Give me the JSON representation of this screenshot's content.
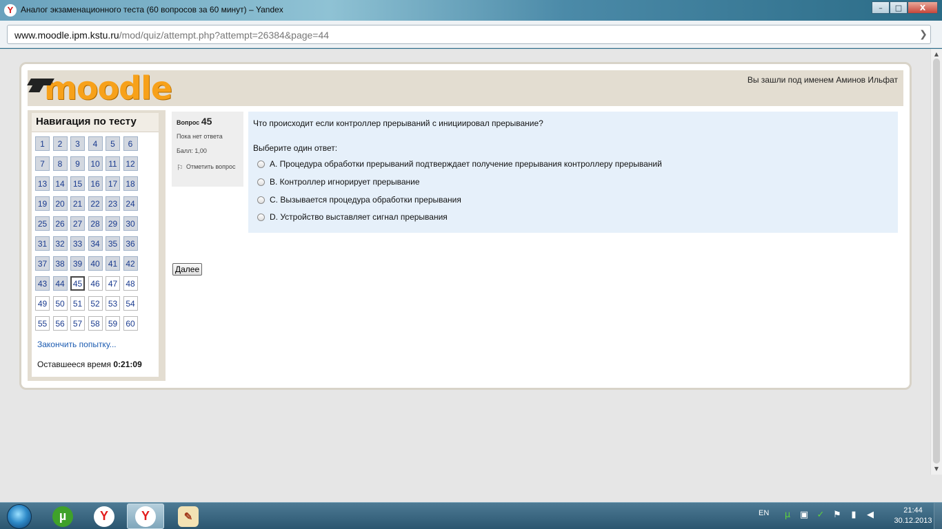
{
  "window": {
    "title": "Аналог экзаменационного теста (60 вопросов за 60 минут) – Yandex",
    "buttons": {
      "minimize": "–",
      "maximize": "□",
      "close": "X"
    }
  },
  "address": {
    "host": "www.moodle.ipm.kstu.ru",
    "path": "/mod/quiz/attempt.php?attempt=26384&page=44",
    "arrow": "❯"
  },
  "header": {
    "logo": "moodle",
    "login_info": "Вы зашли под именем Аминов Ильфат"
  },
  "nav": {
    "title": "Навигация по тесту",
    "questions": [
      {
        "n": "1",
        "s": "answered"
      },
      {
        "n": "2",
        "s": "answered"
      },
      {
        "n": "3",
        "s": "answered"
      },
      {
        "n": "4",
        "s": "answered"
      },
      {
        "n": "5",
        "s": "answered"
      },
      {
        "n": "6",
        "s": "answered"
      },
      {
        "n": "7",
        "s": "answered"
      },
      {
        "n": "8",
        "s": "answered"
      },
      {
        "n": "9",
        "s": "answered"
      },
      {
        "n": "10",
        "s": "answered"
      },
      {
        "n": "11",
        "s": "answered"
      },
      {
        "n": "12",
        "s": "answered"
      },
      {
        "n": "13",
        "s": "answered"
      },
      {
        "n": "14",
        "s": "answered"
      },
      {
        "n": "15",
        "s": "answered"
      },
      {
        "n": "16",
        "s": "answered"
      },
      {
        "n": "17",
        "s": "answered"
      },
      {
        "n": "18",
        "s": "answered"
      },
      {
        "n": "19",
        "s": "answered"
      },
      {
        "n": "20",
        "s": "answered"
      },
      {
        "n": "21",
        "s": "answered"
      },
      {
        "n": "22",
        "s": "answered"
      },
      {
        "n": "23",
        "s": "answered"
      },
      {
        "n": "24",
        "s": "answered"
      },
      {
        "n": "25",
        "s": "answered"
      },
      {
        "n": "26",
        "s": "answered"
      },
      {
        "n": "27",
        "s": "answered"
      },
      {
        "n": "28",
        "s": "answered"
      },
      {
        "n": "29",
        "s": "answered"
      },
      {
        "n": "30",
        "s": "answered"
      },
      {
        "n": "31",
        "s": "answered"
      },
      {
        "n": "32",
        "s": "answered"
      },
      {
        "n": "33",
        "s": "answered"
      },
      {
        "n": "34",
        "s": "answered"
      },
      {
        "n": "35",
        "s": "answered"
      },
      {
        "n": "36",
        "s": "answered"
      },
      {
        "n": "37",
        "s": "answered"
      },
      {
        "n": "38",
        "s": "answered"
      },
      {
        "n": "39",
        "s": "answered"
      },
      {
        "n": "40",
        "s": "answered"
      },
      {
        "n": "41",
        "s": "answered"
      },
      {
        "n": "42",
        "s": "answered"
      },
      {
        "n": "43",
        "s": "answered"
      },
      {
        "n": "44",
        "s": "answered"
      },
      {
        "n": "45",
        "s": "current"
      },
      {
        "n": "46",
        "s": "empty"
      },
      {
        "n": "47",
        "s": "empty"
      },
      {
        "n": "48",
        "s": "empty"
      },
      {
        "n": "49",
        "s": "empty"
      },
      {
        "n": "50",
        "s": "empty"
      },
      {
        "n": "51",
        "s": "empty"
      },
      {
        "n": "52",
        "s": "empty"
      },
      {
        "n": "53",
        "s": "empty"
      },
      {
        "n": "54",
        "s": "empty"
      },
      {
        "n": "55",
        "s": "empty"
      },
      {
        "n": "56",
        "s": "empty"
      },
      {
        "n": "57",
        "s": "empty"
      },
      {
        "n": "58",
        "s": "empty"
      },
      {
        "n": "59",
        "s": "empty"
      },
      {
        "n": "60",
        "s": "empty"
      }
    ],
    "finish_link": "Закончить попытку...",
    "time_label": "Оставшееся время",
    "time_value": "0:21:09"
  },
  "question": {
    "label": "Вопрос",
    "number": "45",
    "state": "Пока нет ответа",
    "grade": "Балл: 1,00",
    "flag": "Отметить вопрос",
    "text": "Что происходит если контроллер прерываний с инициировал прерывание?",
    "prompt": "Выберите один ответ:",
    "answers": [
      "A. Процедура обработки прерываний подтверждает получение прерывания контроллеру прерываний",
      "B. Контроллер игнорирует прерывание",
      "C. Вызывается процедура обработки прерывания",
      "D. Устройство выставляет сигнал прерывания"
    ],
    "next_button": "Далее"
  },
  "taskbar": {
    "lang": "EN",
    "time": "21:44",
    "date": "30.12.2013",
    "task_glyphs": {
      "torrent": "µ",
      "yandex": "Y",
      "paint": "✎"
    }
  }
}
